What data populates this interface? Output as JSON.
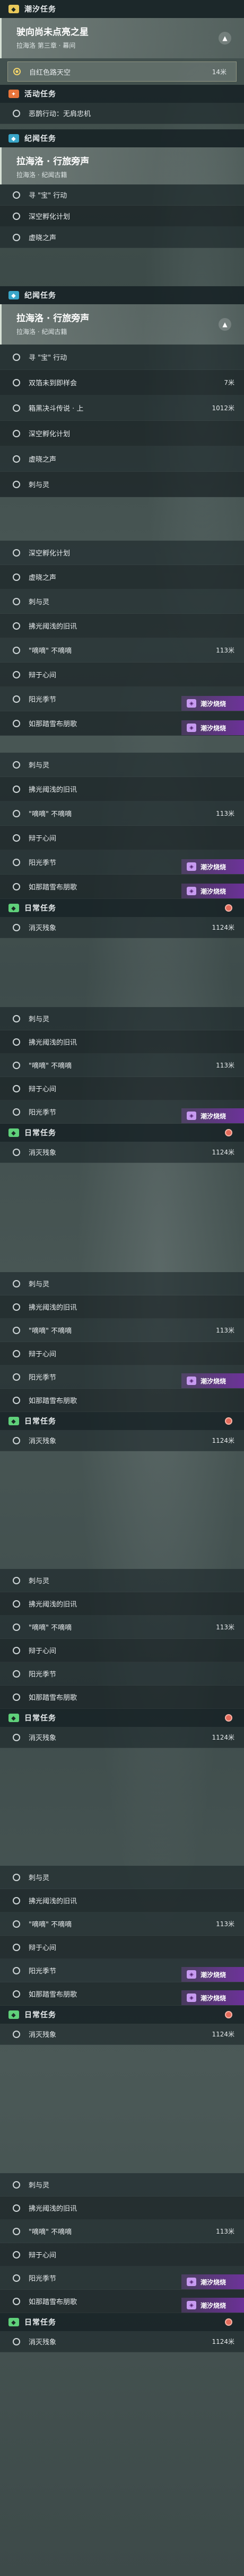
{
  "categories": {
    "main": "潮汐任务",
    "event": "活动任务",
    "story": "纪闻任务",
    "daily": "日常任务"
  },
  "main_quest": {
    "title": "驶向尚未点亮之星",
    "subtitle": "拉海洛 第三章 · 幕间",
    "active_step": "自红色路天空",
    "active_dist": "14米"
  },
  "event_quest": {
    "label": "恶鹊行动：无肩忠机"
  },
  "story_quest": {
    "title": "拉海洛 · 行旅旁声",
    "subtitle": "拉海洛 · 纪闻古籍"
  },
  "story_steps": {
    "s1": "寻 \"宝\" 行动",
    "s2": "双箔未到即样会",
    "s2_dist": "7米",
    "s3": "箱黑决斗传说 · 上",
    "s3_dist": "1012米",
    "s4": "深空孵化计划",
    "s5": "虚晓之声",
    "s6": "刺与灵"
  },
  "repeat": {
    "r_a": "深空孵化计划",
    "r_b": "虚晓之声",
    "r_c": "刺与灵",
    "r_d": "拂光阈浅的旧讯",
    "r_e": "\"嘀嘀\" 不嘀嘀",
    "r_e_dist": "113米",
    "r_f": "辩于心间",
    "r_g": "阳光季节",
    "r_h": "如那踏雪布朋歌",
    "r_i": "消灭残象",
    "r_i_dist": "1124米",
    "badge": "潮汐烧烧"
  }
}
